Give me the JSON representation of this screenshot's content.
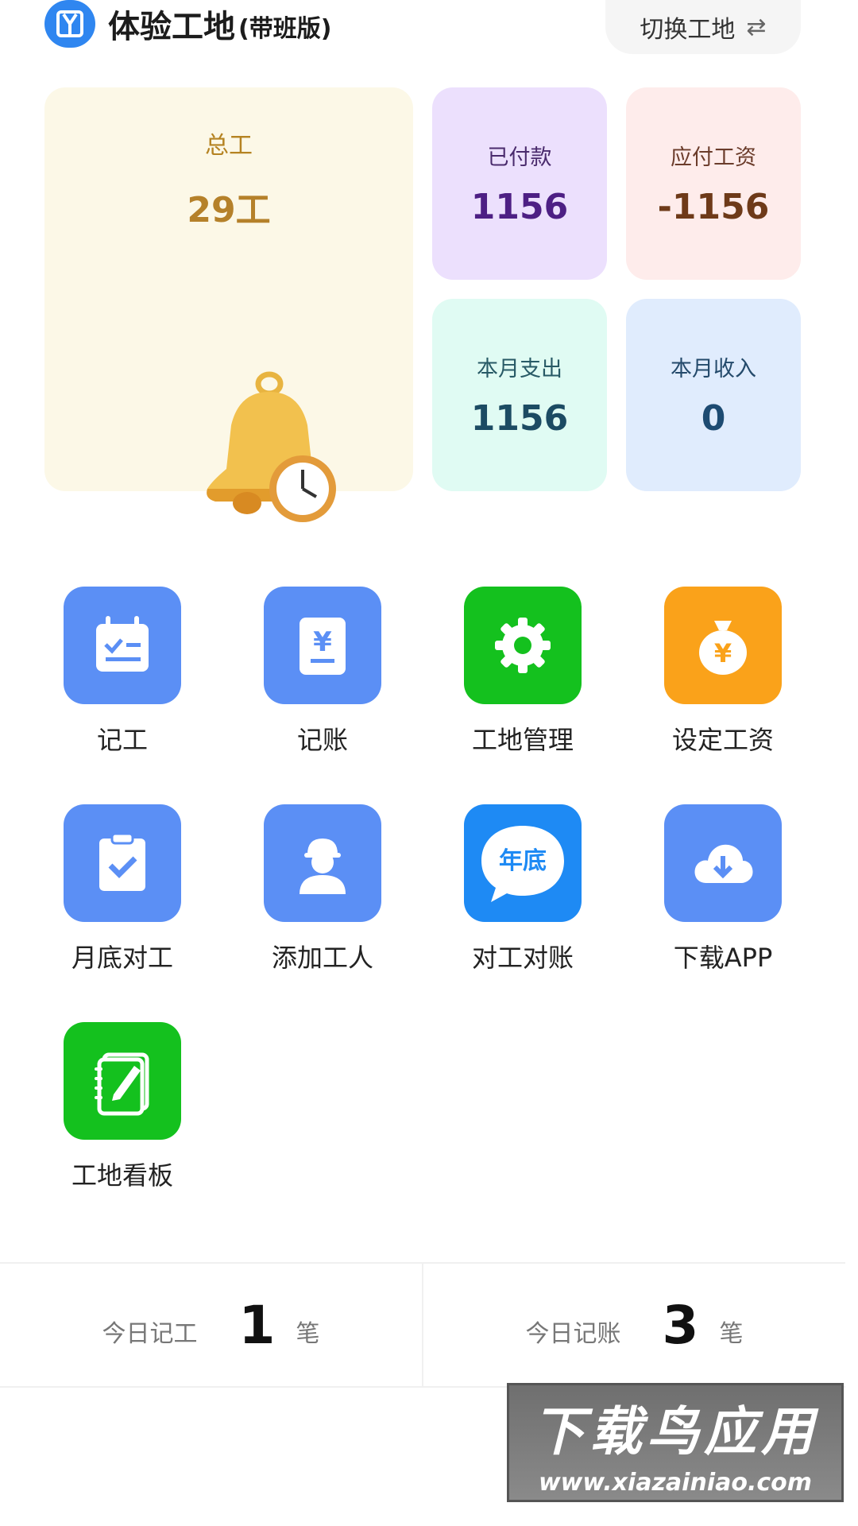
{
  "header": {
    "title": "体验工地",
    "subtitle": "(带班版)",
    "switch_label": "切换工地",
    "switch_icon": "swap-arrows-icon"
  },
  "stats": {
    "total": {
      "label": "总工",
      "value": "29工"
    },
    "paid": {
      "label": "已付款",
      "value": "1156"
    },
    "due": {
      "label": "应付工资",
      "value": "-1156"
    },
    "month_out": {
      "label": "本月支出",
      "value": "1156"
    },
    "month_in": {
      "label": "本月收入",
      "value": "0"
    }
  },
  "functions": [
    {
      "label": "记工",
      "icon": "calendar-check-icon",
      "color": "#5b8ff5"
    },
    {
      "label": "记账",
      "icon": "yuan-doc-icon",
      "color": "#5b8ff5"
    },
    {
      "label": "工地管理",
      "icon": "gear-icon",
      "color": "#14c11e"
    },
    {
      "label": "设定工资",
      "icon": "money-bag-icon",
      "color": "#faa21a"
    },
    {
      "label": "月底对工",
      "icon": "clipboard-check-icon",
      "color": "#5b8ff5"
    },
    {
      "label": "添加工人",
      "icon": "worker-icon",
      "color": "#5b8ff5"
    },
    {
      "label": "对工对账",
      "icon": "year-end-bubble-icon",
      "color": "#1e8af4",
      "badge": "年底"
    },
    {
      "label": "下载APP",
      "icon": "cloud-download-icon",
      "color": "#5b8ff5"
    },
    {
      "label": "工地看板",
      "icon": "notebook-pen-icon",
      "color": "#14c11e"
    }
  ],
  "today": {
    "work": {
      "label": "今日记工",
      "count": "1",
      "unit": "笔"
    },
    "account": {
      "label": "今日记账",
      "count": "3",
      "unit": "笔"
    }
  },
  "watermark": {
    "line1": "下载鸟应用",
    "line2": "www.xiazainiao.com"
  }
}
